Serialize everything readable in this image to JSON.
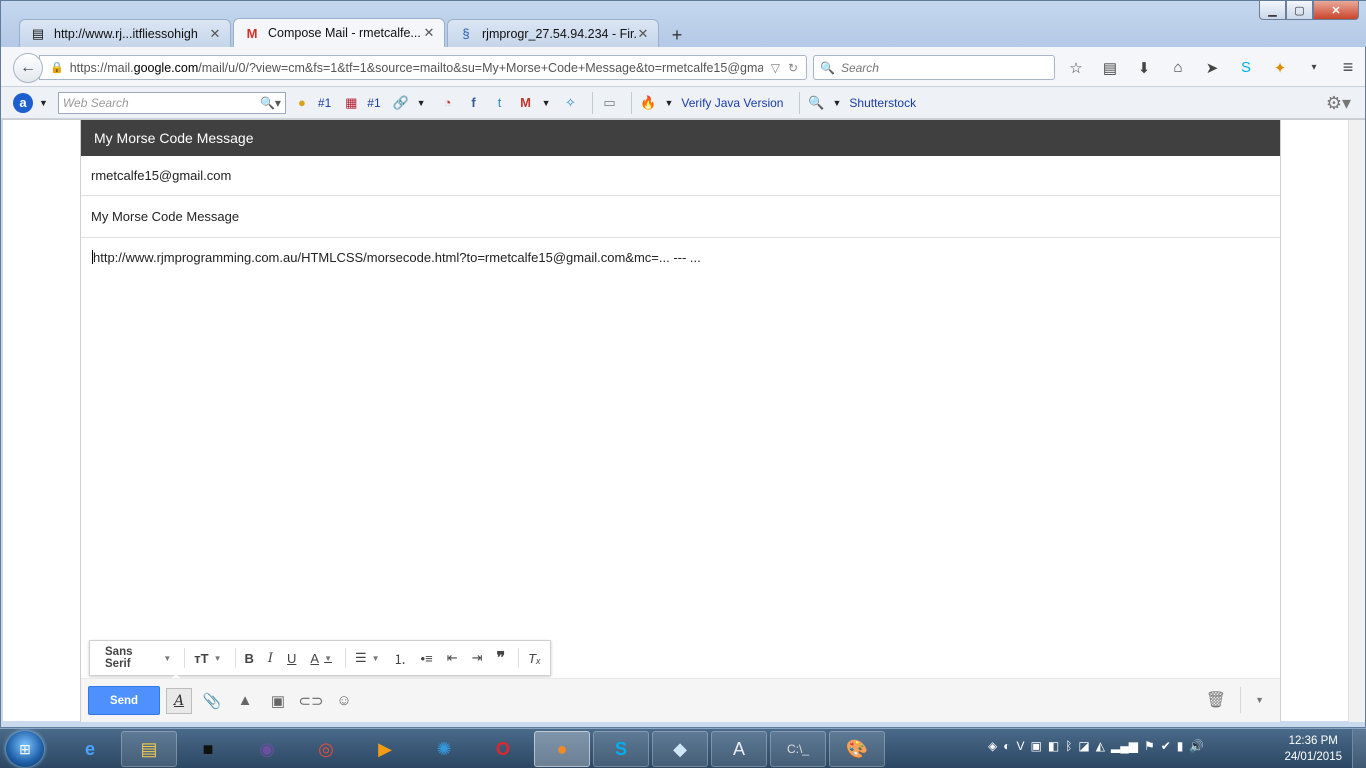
{
  "browser": {
    "tabs": [
      {
        "title": "http://www.rj...itfliessohigh",
        "icon": "page-icon"
      },
      {
        "title": "Compose Mail - rmetcalfe...",
        "icon": "gmail-icon"
      },
      {
        "title": "rjmprogr_27.54.94.234 - Fir...",
        "icon": "filezilla-icon"
      }
    ],
    "url_prefix": "https://mail.",
    "url_domain": "google.com",
    "url_rest": "/mail/u/0/?view=cm&fs=1&tf=1&source=mailto&su=My+Morse+Code+Message&to=rmetcalfe15@gma",
    "search_placeholder": "Search"
  },
  "toolbar": {
    "web_search_placeholder": "Web Search",
    "rank1": "#1",
    "rank2": "#1",
    "verify_java": "Verify Java Version",
    "shutterstock": "Shutterstock"
  },
  "compose": {
    "header_title": "My Morse Code Message",
    "to": "rmetcalfe15@gmail.com",
    "subject": "My Morse Code Message",
    "body": "http://www.rjmprogramming.com.au/HTMLCSS/morsecode.html?to=rmetcalfe15@gmail.com&mc=... --- ...",
    "format_font": "Sans Serif",
    "send_label": "Send"
  },
  "taskbar": {
    "time": "12:36 PM",
    "date": "24/01/2015"
  },
  "colors": {
    "send_blue": "#4d90fe",
    "header_dark": "#404040"
  }
}
